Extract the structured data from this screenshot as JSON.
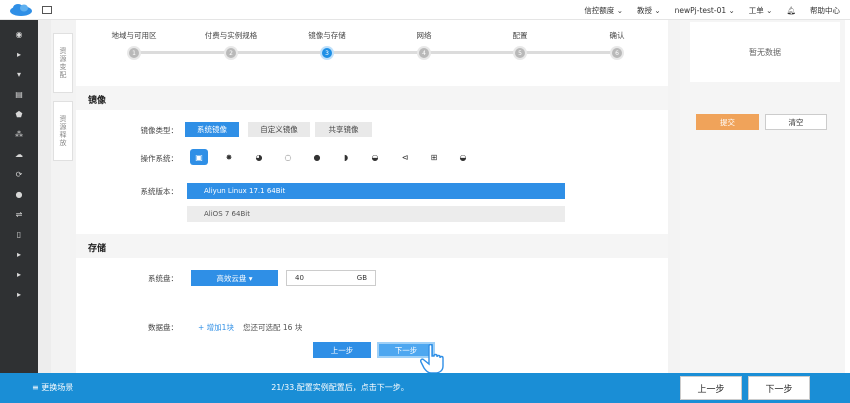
{
  "topbar": {
    "items": [
      "信控额度 ⌄",
      "教授 ⌄",
      "newPj-test-01 ⌄",
      "工单 ⌄",
      "帮助中心"
    ],
    "bell_icon": "bell-icon"
  },
  "left_tabs": [
    "资源变配",
    "资源释放"
  ],
  "steps": [
    {
      "label": "地域与可用区",
      "num": "1"
    },
    {
      "label": "付费与实例规格",
      "num": "2"
    },
    {
      "label": "镜像与存储",
      "num": "3"
    },
    {
      "label": "网络",
      "num": "4"
    },
    {
      "label": "配置",
      "num": "5"
    },
    {
      "label": "确认",
      "num": "6"
    }
  ],
  "active_step": 3,
  "image_section": {
    "title": "镜像",
    "type_label": "镜像类型：",
    "types": [
      "系统镜像",
      "自定义镜像",
      "共享镜像"
    ],
    "os_label": "操作系统：",
    "os_icons": [
      "aliyun-os-icon",
      "centos-icon",
      "debian-icon",
      "opensuse-icon",
      "freebsd-icon",
      "coreos-icon",
      "suse-icon",
      "ubuntu-icon",
      "windows-icon",
      "suse-alt-icon"
    ],
    "version_label": "系统版本：",
    "versions": [
      "Aliyun Linux 17.1 64Bit",
      "AliOS 7 64Bit"
    ]
  },
  "storage_section": {
    "title": "存储",
    "system_disk_label": "系统盘：",
    "disk_type": "高效云盘 ▾",
    "disk_size": "40",
    "disk_unit": "GB",
    "data_disk_label": "数据盘：",
    "add_disk": "+ 增加1块",
    "disk_hint": "您还可选配 16 块"
  },
  "actions": {
    "prev": "上一步",
    "next": "下一步"
  },
  "right_panel": {
    "no_data": "暂无数据",
    "submit": "提交",
    "clear": "清空"
  },
  "bottombar": {
    "left": "≡ 更换场景",
    "center": "21/33.配置实例配置后，点击下一步。",
    "prev": "上一步",
    "next": "下一步"
  },
  "colors": {
    "accent": "#2f8fe6",
    "sidebar": "#2f3133",
    "bottombar": "#1a8ed6",
    "submit": "#f0a35a"
  }
}
